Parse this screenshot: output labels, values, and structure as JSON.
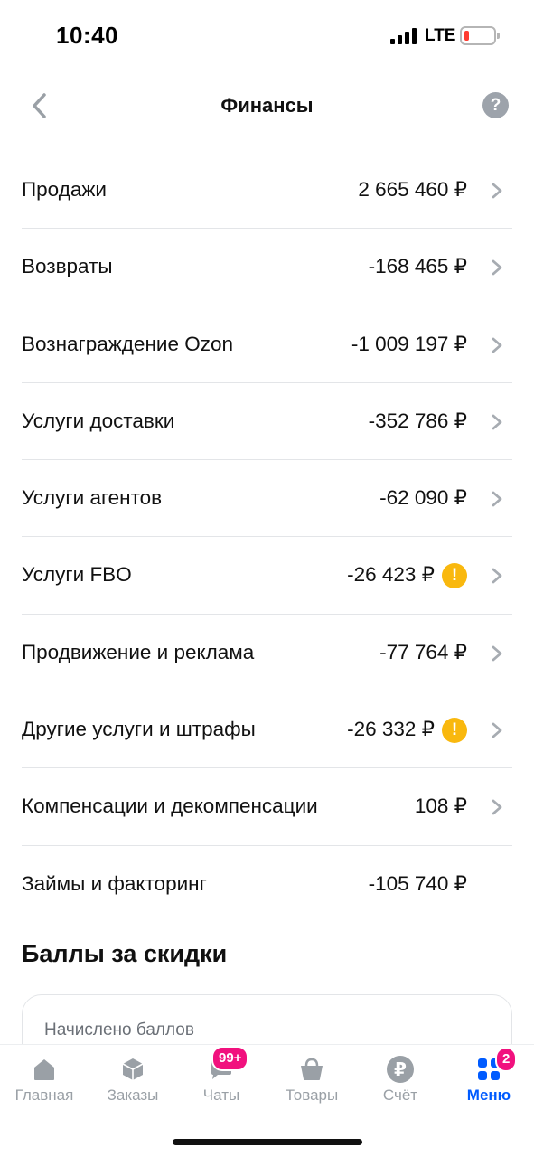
{
  "status_bar": {
    "time": "10:40",
    "network": "LTE"
  },
  "nav": {
    "title": "Финансы",
    "help_symbol": "?"
  },
  "rows": [
    {
      "label": "Продажи",
      "value": "2 665 460 ₽",
      "warning": false,
      "chevron": true
    },
    {
      "label": "Возвраты",
      "value": "-168 465 ₽",
      "warning": false,
      "chevron": true
    },
    {
      "label": "Вознаграждение Ozon",
      "value": "-1 009 197 ₽",
      "warning": false,
      "chevron": true
    },
    {
      "label": "Услуги доставки",
      "value": "-352 786 ₽",
      "warning": false,
      "chevron": true
    },
    {
      "label": "Услуги агентов",
      "value": "-62 090 ₽",
      "warning": false,
      "chevron": true
    },
    {
      "label": "Услуги FBO",
      "value": "-26 423 ₽",
      "warning": true,
      "chevron": true
    },
    {
      "label": "Продвижение и реклама",
      "value": "-77 764 ₽",
      "warning": false,
      "chevron": true
    },
    {
      "label": "Другие услуги и штрафы",
      "value": "-26 332 ₽",
      "warning": true,
      "chevron": true
    },
    {
      "label": "Компенсации и декомпенсации",
      "value": "108 ₽",
      "warning": false,
      "chevron": true
    },
    {
      "label": "Займы и факторинг",
      "value": "-105 740 ₽",
      "warning": false,
      "chevron": false
    }
  ],
  "warning_symbol": "!",
  "points_section": {
    "title": "Баллы за скидки",
    "card_label": "Начислено баллов"
  },
  "tabs": [
    {
      "label": "Главная",
      "icon": "home-icon",
      "active": false
    },
    {
      "label": "Заказы",
      "icon": "box-icon",
      "active": false
    },
    {
      "label": "Чаты",
      "icon": "chat-icon",
      "active": false,
      "badge": "99+"
    },
    {
      "label": "Товары",
      "icon": "basket-icon",
      "active": false
    },
    {
      "label": "Счёт",
      "icon": "ruble-icon",
      "active": false,
      "ruble_symbol": "₽"
    },
    {
      "label": "Меню",
      "icon": "menu-grid-icon",
      "active": true,
      "badge": "2"
    }
  ],
  "colors": {
    "accent": "#005bff",
    "warning": "#f9b80e",
    "badge": "#f1117e",
    "inactive_icon": "#9aa0a6",
    "battery_low": "#ff3b30"
  }
}
